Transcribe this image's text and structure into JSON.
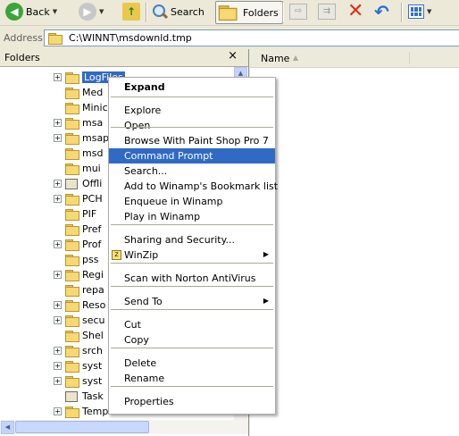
{
  "toolbar": {
    "back_label": "Back",
    "search_label": "Search",
    "folders_label": "Folders"
  },
  "address": {
    "label": "Address",
    "path": "C:\\WINNT\\msdownld.tmp"
  },
  "folders_pane": {
    "title": "Folders",
    "close": "×",
    "tree": [
      {
        "label": "LogFiles",
        "expander": "+",
        "selected": true
      },
      {
        "label": "Med",
        "expander": ""
      },
      {
        "label": "Minic",
        "expander": ""
      },
      {
        "label": "msa",
        "expander": "+"
      },
      {
        "label": "msap",
        "expander": "+"
      },
      {
        "label": "msd",
        "expander": ""
      },
      {
        "label": "mui",
        "expander": ""
      },
      {
        "label": "Offli",
        "expander": "+",
        "special": true
      },
      {
        "label": "PCH",
        "expander": "+"
      },
      {
        "label": "PIF",
        "expander": ""
      },
      {
        "label": "Pref",
        "expander": ""
      },
      {
        "label": "Prof",
        "expander": "+"
      },
      {
        "label": "pss",
        "expander": ""
      },
      {
        "label": "Regi",
        "expander": "+"
      },
      {
        "label": "repa",
        "expander": ""
      },
      {
        "label": "Reso",
        "expander": "+"
      },
      {
        "label": "secu",
        "expander": "+"
      },
      {
        "label": "Shel",
        "expander": ""
      },
      {
        "label": "srch",
        "expander": "+"
      },
      {
        "label": "syst",
        "expander": "+"
      },
      {
        "label": "syst",
        "expander": "+"
      },
      {
        "label": "Task",
        "expander": "",
        "special": true
      },
      {
        "label": "Temp",
        "expander": "+"
      }
    ]
  },
  "file_pane": {
    "column_name": "Name"
  },
  "context_menu": {
    "items": [
      {
        "label": "Expand",
        "bold": true
      },
      {
        "label": "Explore"
      },
      {
        "label": "Open"
      },
      {
        "label": "Browse With Paint Shop Pro 7"
      },
      {
        "label": "Command Prompt",
        "highlighted": true
      },
      {
        "label": "Search..."
      },
      {
        "label": "Add to Winamp's Bookmark list"
      },
      {
        "label": "Enqueue in Winamp"
      },
      {
        "label": "Play in Winamp"
      },
      {
        "label": "Sharing and Security..."
      },
      {
        "label": "WinZip",
        "submenu": true
      },
      {
        "label": "Scan with Norton AntiVirus"
      },
      {
        "label": "Send To",
        "submenu": true
      },
      {
        "label": "Cut"
      },
      {
        "label": "Copy"
      },
      {
        "label": "Delete"
      },
      {
        "label": "Rename"
      },
      {
        "label": "Properties"
      }
    ]
  }
}
